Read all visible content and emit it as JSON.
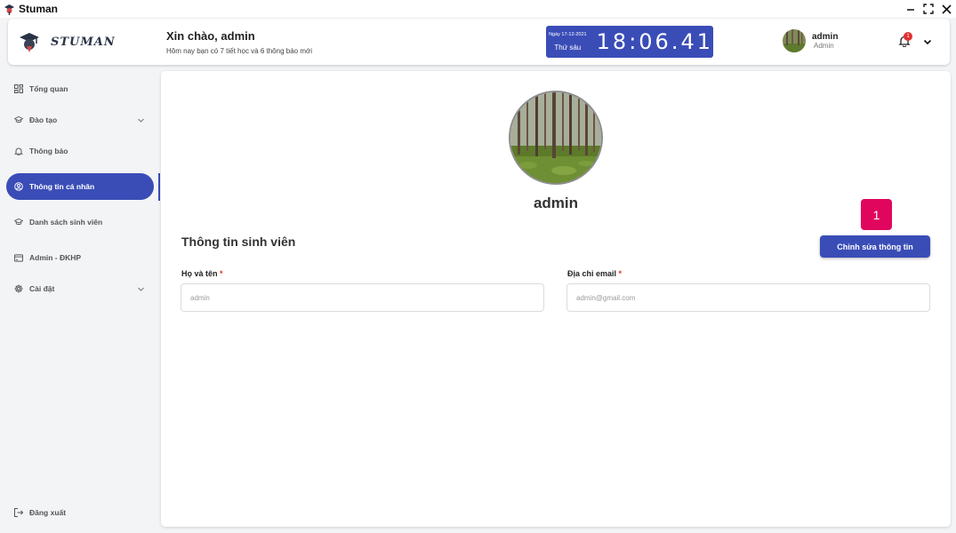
{
  "window": {
    "title": "Stuman"
  },
  "header": {
    "logo_text": "STUMAN",
    "greeting_title": "Xin chào,  admin",
    "greeting_sub": "Hôm nay bạn có 7 tiết học và 6 thông báo mới",
    "clock": {
      "date": "Ngày 17-12-2021",
      "day": "Thứ sáu",
      "time": "18:06.41"
    },
    "user": {
      "name": "admin",
      "role": "Admin"
    },
    "notification_count": "1"
  },
  "sidebar": {
    "items": [
      {
        "label": "Tổng quan",
        "icon": "grid-icon"
      },
      {
        "label": "Đào tạo",
        "icon": "graduation-cap-icon"
      },
      {
        "label": "Thông báo",
        "icon": "bell-icon"
      },
      {
        "label": "Thông tin cá nhân",
        "icon": "user-circle-icon"
      },
      {
        "label": "Danh sách sinh viên",
        "icon": "graduation-cap-icon"
      },
      {
        "label": "Admin - ĐKHP",
        "icon": "card-icon"
      },
      {
        "label": "Cài đặt",
        "icon": "gear-icon"
      }
    ],
    "logout_label": "Đăng xuất"
  },
  "profile": {
    "name": "admin",
    "step_badge": "1",
    "section_title": "Thông tin sinh viên",
    "edit_button": "Chỉnh sửa thông tin",
    "fields": {
      "name_label": "Họ và tên",
      "name_value": "admin",
      "email_label": "Địa chỉ email",
      "email_value": "admin@gmail.com",
      "required_mark": "*"
    }
  },
  "colors": {
    "primary": "#3a4db7",
    "badge": "#e0065d",
    "required": "#e03131"
  }
}
